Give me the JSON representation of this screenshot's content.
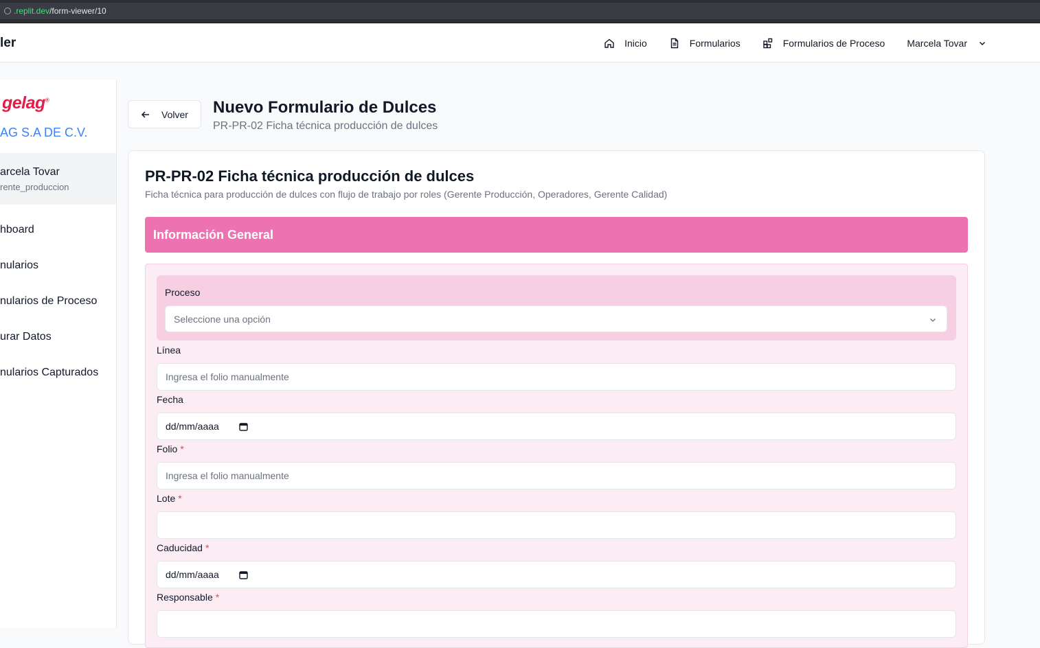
{
  "browser": {
    "url_domain": ".replit.dev",
    "url_path": "/form-viewer/10"
  },
  "topnav": {
    "brand": "ler",
    "items": [
      {
        "label": "Inicio",
        "icon": "home-icon"
      },
      {
        "label": "Formularios",
        "icon": "document-icon"
      },
      {
        "label": "Formularios de Proceso",
        "icon": "blocks-icon"
      }
    ],
    "user_name": "Marcela Tovar"
  },
  "sidebar": {
    "logo": "gelag",
    "logo_mark": "®",
    "company": "AG S.A DE C.V.",
    "user_name": "arcela Tovar",
    "user_role": "rente_produccion",
    "items": [
      {
        "label": "hboard"
      },
      {
        "label": "nularios"
      },
      {
        "label": "nularios de Proceso"
      },
      {
        "label": "urar Datos"
      },
      {
        "label": "nularios Capturados"
      }
    ]
  },
  "header": {
    "back_label": "Volver",
    "title": "Nuevo Formulario de Dulces",
    "subtitle": "PR-PR-02 Ficha técnica producción de dulces"
  },
  "form": {
    "title": "PR-PR-02 Ficha técnica producción de dulces",
    "description": "Ficha técnica para producción de dulces con flujo de trabajo por roles (Gerente Producción, Operadores, Gerente Calidad)",
    "section_title": "Información General",
    "proceso": {
      "label": "Proceso",
      "placeholder": "Seleccione una opción"
    },
    "linea": {
      "label": "Línea",
      "placeholder": "Ingresa el folio manualmente"
    },
    "fecha": {
      "label": "Fecha",
      "value": "dd/mm/aaaa"
    },
    "folio": {
      "label": "Folio",
      "required_mark": "*",
      "placeholder": "Ingresa el folio manualmente"
    },
    "lote": {
      "label": "Lote",
      "required_mark": "*",
      "value": ""
    },
    "caducidad": {
      "label": "Caducidad",
      "required_mark": "*",
      "value": "dd/mm/aaaa"
    },
    "responsable": {
      "label": "Responsable",
      "required_mark": "*",
      "value": ""
    }
  },
  "colors": {
    "section_bar": "#ec72b0",
    "section_body": "#fcedf4",
    "proceso_box": "#f6cfe2",
    "company": "#3b82f6",
    "logo": "#e11d48"
  }
}
